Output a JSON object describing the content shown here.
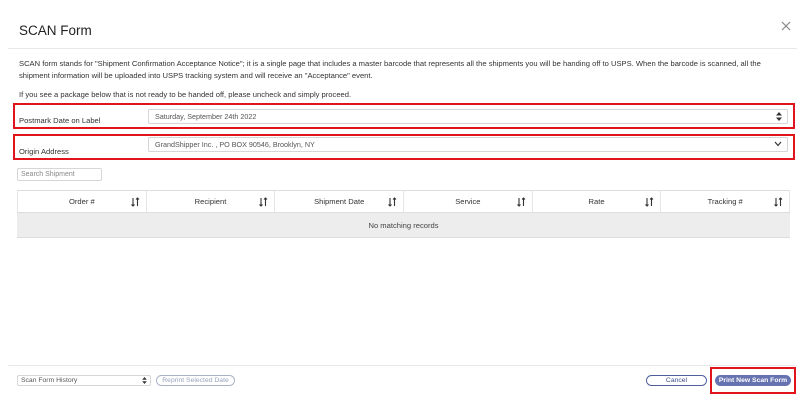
{
  "modal": {
    "title": "SCAN Form",
    "description": "SCAN form stands for \"Shipment Confirmation Acceptance Notice\"; it is a single page that includes a master barcode that represents all the shipments you will be handing off to USPS. When the barcode is scanned, all the shipment information will be uploaded into USPS tracking system and will receive an \"Acceptance\" event.",
    "instruction": "If you see a package below that is not ready to be handed off, please uncheck and simply proceed."
  },
  "postmark": {
    "label": "Postmark Date on Label",
    "value": "Saturday, September 24th 2022"
  },
  "origin": {
    "label": "Origin Address",
    "value": "GrandShipper Inc. , PO BOX 90546, Brooklyn, NY"
  },
  "search": {
    "placeholder": "Search Shipment"
  },
  "table": {
    "columns": [
      "Order #",
      "Recipient",
      "Shipment Date",
      "Service",
      "Rate",
      "Tracking #"
    ],
    "empty_message": "No matching records"
  },
  "footer": {
    "history_select": "Scan Form History",
    "reprint_label": "Reprint Selected Date",
    "cancel_label": "Cancel",
    "print_label": "Print New Scan Form"
  },
  "colors": {
    "highlight": "#e1141b",
    "primary_button": "#6673b0",
    "cancel_border": "#4f5f9c"
  },
  "icons": {
    "close": "close-icon",
    "sort": "sort-icon",
    "select_updown": "select-updown-icon",
    "select_down": "chevron-down-icon"
  }
}
